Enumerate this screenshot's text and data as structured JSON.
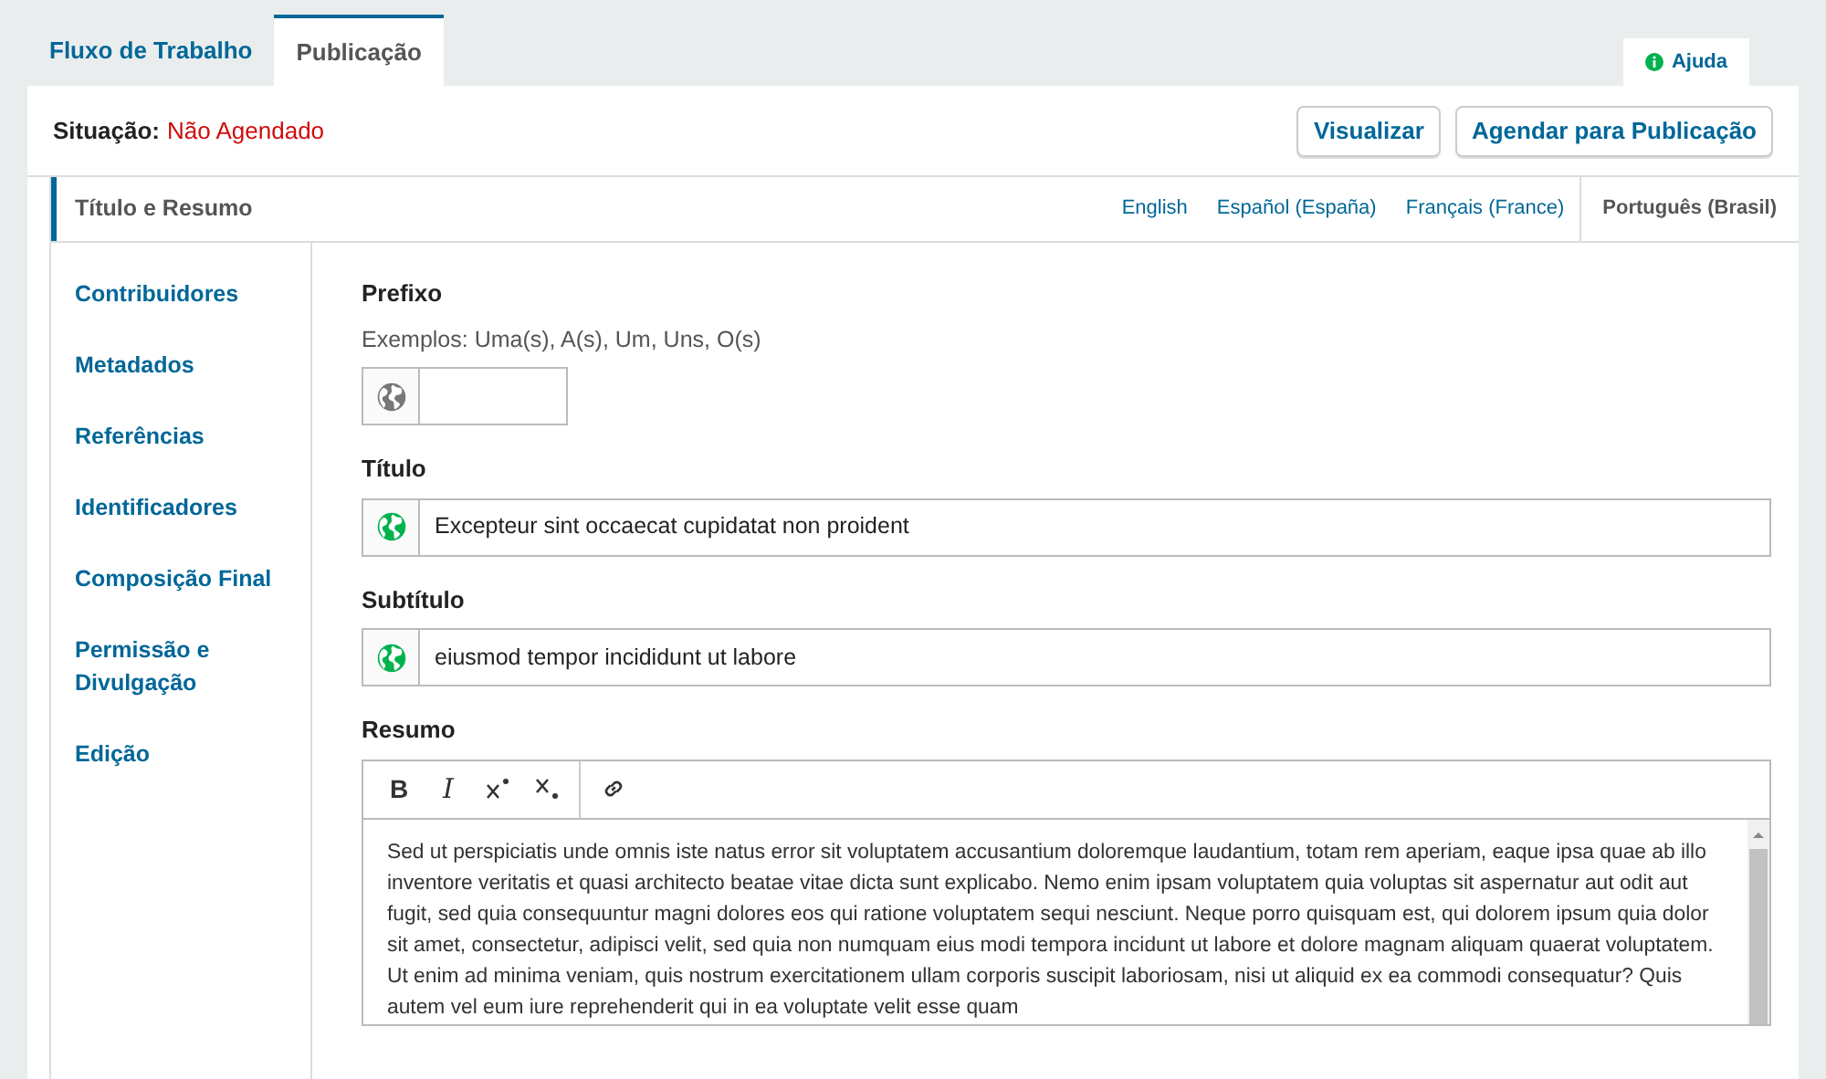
{
  "tabs": [
    {
      "label": "Fluxo de Trabalho",
      "selected": false
    },
    {
      "label": "Publicação",
      "selected": true
    }
  ],
  "help": {
    "label": "Ajuda"
  },
  "status": {
    "label": "Situação:",
    "value": "Não Agendado"
  },
  "actions": [
    "Visualizar",
    "Agendar para Publicação"
  ],
  "sidebar": {
    "items": [
      {
        "label": "Título e Resumo",
        "selected": true
      },
      {
        "label": "Contribuidores",
        "selected": false
      },
      {
        "label": "Metadados",
        "selected": false
      },
      {
        "label": "Referências",
        "selected": false
      },
      {
        "label": "Identificadores",
        "selected": false
      },
      {
        "label": "Composição Final",
        "selected": false
      },
      {
        "label": "Permissão e Divulgação",
        "selected": false
      },
      {
        "label": "Edição",
        "selected": false
      }
    ]
  },
  "locales": [
    {
      "label": "English",
      "selected": false
    },
    {
      "label": "Español (España)",
      "selected": false
    },
    {
      "label": "Français (France)",
      "selected": false
    },
    {
      "label": "Português (Brasil)",
      "selected": true
    }
  ],
  "form": {
    "prefix": {
      "label": "Prefixo",
      "description": "Exemplos: Uma(s), A(s), Um, Uns, O(s)",
      "translated": false
    },
    "title": {
      "label": "Título",
      "value": "Excepteur sint occaecat cupidatat non proident",
      "translated": true
    },
    "subtitle": {
      "label": "Subtítulo",
      "value": "eiusmod tempor incididunt ut labore",
      "translated": true
    },
    "abstract": {
      "label": "Resumo",
      "toolbar": [
        {
          "kind": "bold",
          "label": "B"
        },
        {
          "kind": "italic",
          "label": "I"
        },
        {
          "kind": "superscript"
        },
        {
          "kind": "subscript"
        },
        {
          "kind": "link"
        }
      ],
      "text": "Sed ut perspiciatis unde omnis iste natus error sit voluptatem accusantium doloremque laudantium, totam rem aperiam, eaque ipsa quae ab illo inventore veritatis et quasi architecto beatae vitae dicta sunt explicabo. Nemo enim ipsam voluptatem quia voluptas sit aspernatur aut odit aut fugit, sed quia consequuntur magni dolores eos qui ratione voluptatem sequi nesciunt. Neque porro quisquam est, qui dolorem ipsum quia dolor sit amet, consectetur, adipisci velit, sed quia non numquam eius modi tempora incidunt ut labore et dolore magnam aliquam quaerat voluptatem. Ut enim ad minima veniam, quis nostrum exercitationem ullam corporis suscipit laboriosam, nisi ut aliquid ex ea commodi consequatur? Quis autem vel eum iure reprehenderit qui in ea voluptate velit esse quam"
    }
  }
}
